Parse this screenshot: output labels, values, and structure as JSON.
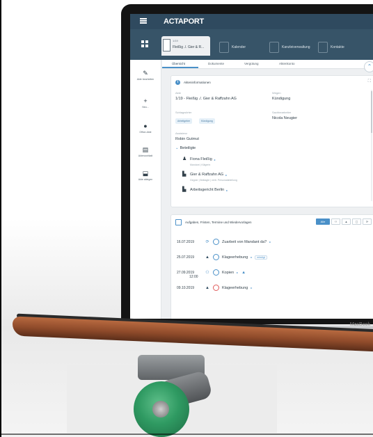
{
  "app": {
    "logo": "ACTAPORT",
    "case_tab": {
      "number": "1/19",
      "title": "Fleißig ./. Gier & R..."
    },
    "nav_tabs": [
      "Kalender",
      "Kanzleiverwaltung",
      "Kontakte"
    ],
    "sidebar": [
      {
        "icon": "pencil-icon",
        "glyph": "✎",
        "label": "Akte bearbeiten"
      },
      {
        "icon": "plus-icon",
        "glyph": "+",
        "label": "Neu..."
      },
      {
        "icon": "office-icon",
        "glyph": "●",
        "label": "Office-Akte"
      },
      {
        "icon": "clipboard-icon",
        "glyph": "▤",
        "label": "Aktenvorblatt"
      },
      {
        "icon": "archive-icon",
        "glyph": "⬓",
        "label": "Akte ablegen"
      }
    ],
    "subtabs": [
      "Übersicht",
      "Dokumente",
      "Vergütung",
      "Aktenkonto"
    ]
  },
  "akteninfo": {
    "header": "Akteninformationen",
    "akte_label": "Akte",
    "akte_value": "1/19 - Fleißig ./. Gier & Raffzahn AG",
    "wegen_label": "Wegen",
    "wegen_value": "Kündigung",
    "schlagwoerter_label": "Schlagwörter",
    "chips": [
      "Arbeitgeber",
      "Kündigung"
    ],
    "sachbearbeiter_label": "Sachbearbeiter",
    "sachbearbeiter_value": "Nicola Neugier",
    "assistenz_label": "Assistenz",
    "assistenz_value": "Robin Gutmut",
    "beteiligte_label": "Beteiligte",
    "parties": [
      {
        "name": "Fiona Fleißig",
        "sub": "Mandant | Klägerin",
        "icon": "person-icon"
      },
      {
        "name": "Gier & Raffzahn AG",
        "sub": "Gegner | Beklagte | vertr. Personalabteilung",
        "icon": "building-icon"
      },
      {
        "name": "Arbeitsgericht Berlin",
        "sub": "",
        "icon": "court-icon"
      }
    ]
  },
  "aufgaben": {
    "header": "Aufgaben, Fristen, Termine und Wiedervorlagen",
    "filter_all": "Alle",
    "tasks": [
      {
        "date": "16.07.2019",
        "icon": "refresh-icon",
        "glyph": "⟳",
        "text": "Zuarbeit von Mandant da?",
        "tag": "",
        "red": false,
        "color": "#4a90c8"
      },
      {
        "date": "25.07.2019",
        "icon": "bell-icon",
        "glyph": "▲",
        "text": "Klageerhebung",
        "tag": "erledigt",
        "red": false,
        "color": "#2f4a5f"
      },
      {
        "date": "27.09.2019",
        "time": "12:00",
        "icon": "people-icon",
        "glyph": "⚇",
        "text": "Kopien",
        "tag": "",
        "red": false,
        "color": "#4a90c8"
      },
      {
        "date": "09.10.2019",
        "icon": "bell-icon",
        "glyph": "▲",
        "text": "Klageerhebung",
        "tag": "",
        "red": true,
        "color": "#2f4a5f"
      }
    ]
  },
  "device": {
    "brand": "MacBook"
  }
}
